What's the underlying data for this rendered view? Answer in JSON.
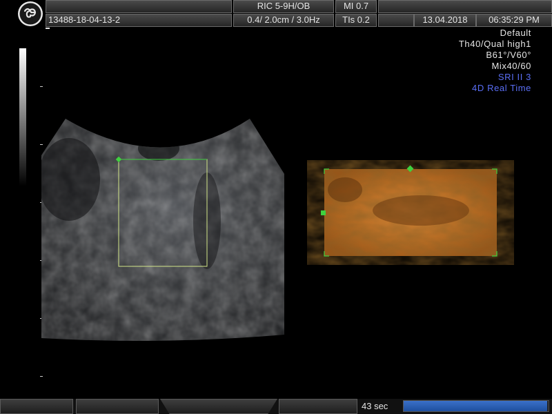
{
  "header": {
    "probe": "RIC 5-9H/OB",
    "mi": "MI  0.7",
    "patient_id": "13488-18-04-13-2",
    "depth_freq": "0.4/ 2.0cm / 3.0Hz",
    "tis": "TIs  0.2",
    "date": "13.04.2018",
    "time": "06:35:29 PM"
  },
  "params": {
    "line1": "Default",
    "line2": "Th40/Qual high1",
    "line3": "B61°/V60°",
    "line4": "Mix40/60",
    "line5": "SRI II 3",
    "line6": "4D Real Time"
  },
  "footer": {
    "timer": "43 sec",
    "progress": 0.99
  },
  "colors": {
    "roi_green": "#3fd13f",
    "render_orange": "#c9762a",
    "params_blue": "#5a6ef5",
    "progress_blue": "#2a5fb4"
  }
}
